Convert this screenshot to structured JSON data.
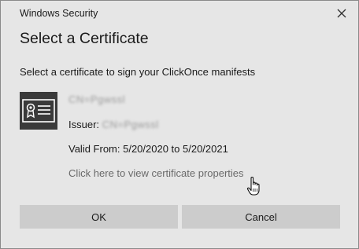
{
  "window": {
    "title": "Windows Security"
  },
  "dialog": {
    "heading": "Select a Certificate",
    "instruction": "Select a certificate to sign your ClickOnce manifests"
  },
  "certificate": {
    "name": "CN=Pgwssl",
    "issuer_label": "Issuer: ",
    "issuer_value": "CN=Pgwssl",
    "valid_from": "Valid From: 5/20/2020 to 5/20/2021",
    "properties_link": "Click here to view certificate properties"
  },
  "buttons": {
    "ok": "OK",
    "cancel": "Cancel"
  },
  "icons": {
    "close": "close-icon",
    "certificate": "certificate-icon",
    "cursor": "hand-pointer-cursor"
  }
}
